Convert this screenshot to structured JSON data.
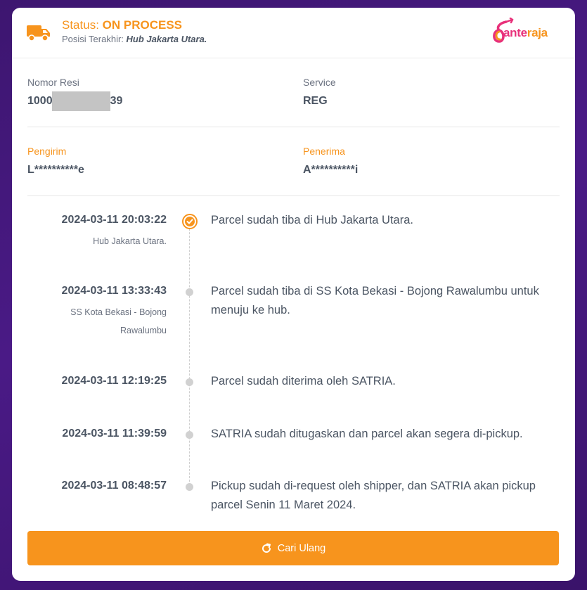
{
  "header": {
    "status_prefix": "Status:",
    "status_value": "ON PROCESS",
    "position_prefix": "Posisi Terakhir:",
    "position_value": "Hub Jakarta Utara.",
    "logo_text_ante": "ante",
    "logo_text_raja": "raja"
  },
  "shipment": {
    "resi_label": "Nomor Resi",
    "resi_prefix": "1000",
    "resi_suffix": "39",
    "service_label": "Service",
    "service_value": "REG",
    "sender_label": "Pengirim",
    "sender_value": "L**********e",
    "receiver_label": "Penerima",
    "receiver_value": "A**********i"
  },
  "timeline": [
    {
      "date": "2024-03-11 20:03:22",
      "location": "Hub Jakarta Utara.",
      "description": "Parcel sudah tiba di Hub Jakarta Utara.",
      "active": true
    },
    {
      "date": "2024-03-11 13:33:43",
      "location": "SS Kota Bekasi - Bojong Rawalumbu",
      "description": "Parcel sudah tiba di SS Kota Bekasi - Bojong Rawalumbu untuk menuju ke hub.",
      "active": false
    },
    {
      "date": "2024-03-11 12:19:25",
      "location": "",
      "description": "Parcel sudah diterima oleh SATRIA.",
      "active": false
    },
    {
      "date": "2024-03-11 11:39:59",
      "location": "",
      "description": "SATRIA sudah ditugaskan dan parcel akan segera di-pickup.",
      "active": false
    },
    {
      "date": "2024-03-11 08:48:57",
      "location": "",
      "description": "Pickup sudah di-request oleh shipper, dan SATRIA akan pickup parcel Senin 11 Maret 2024.",
      "active": false
    }
  ],
  "actions": {
    "retry_label": "Cari Ulang",
    "retry_icon": "refresh-icon"
  },
  "colors": {
    "accent": "#f7941d",
    "brand_pink": "#e8317a",
    "background": "#3d1670"
  }
}
